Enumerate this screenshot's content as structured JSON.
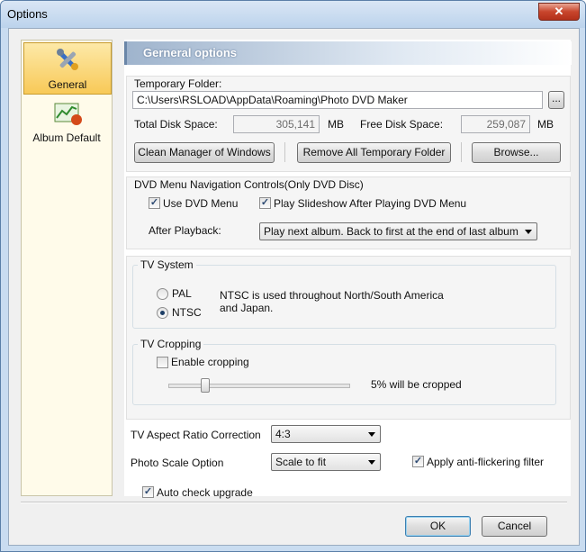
{
  "window": {
    "title": "Options",
    "close_glyph": "✕"
  },
  "sidebar": {
    "items": [
      {
        "label": "General",
        "icon": "tools-icon",
        "selected": true
      },
      {
        "label": "Album Default",
        "icon": "chart-icon",
        "selected": false
      }
    ]
  },
  "header": {
    "title": "Gerneral options"
  },
  "temp_folder": {
    "label": "Temporary Folder:",
    "path": "C:\\Users\\RSLOAD\\AppData\\Roaming\\Photo DVD Maker",
    "browse_dots": "...",
    "total_label": "Total Disk Space:",
    "total_value": "305,141",
    "total_unit": "MB",
    "free_label": "Free Disk Space:",
    "free_value": "259,087",
    "free_unit": "MB",
    "clean_btn": "Clean Manager of Windows",
    "remove_btn": "Remove All Temporary Folder",
    "browse_btn": "Browse..."
  },
  "dvd_menu": {
    "legend": "DVD Menu Navigation Controls(Only DVD Disc)",
    "use_menu_label": "Use DVD Menu",
    "use_menu_checked": true,
    "play_slideshow_label": "Play Slideshow After Playing DVD Menu",
    "play_slideshow_checked": true,
    "after_playback_label": "After Playback:",
    "after_playback_value": "Play next album. Back to first at the end of last album"
  },
  "tv_system": {
    "legend": "TV System",
    "pal_label": "PAL",
    "ntsc_label": "NTSC",
    "selected": "NTSC",
    "description": "NTSC is used throughout North/South America and Japan."
  },
  "tv_cropping": {
    "legend": "TV Cropping",
    "enable_label": "Enable cropping",
    "enable_checked": false,
    "crop_text": "5% will be cropped",
    "slider_fraction": 0.2
  },
  "aspect": {
    "label": "TV Aspect Ratio Correction",
    "value": "4:3"
  },
  "scale": {
    "label": "Photo Scale Option",
    "value": "Scale to fit",
    "anti_flicker_label": "Apply anti-flickering filter",
    "anti_flicker_checked": true
  },
  "auto_upgrade": {
    "label": "Auto check upgrade",
    "checked": true
  },
  "footer": {
    "ok": "OK",
    "cancel": "Cancel"
  }
}
